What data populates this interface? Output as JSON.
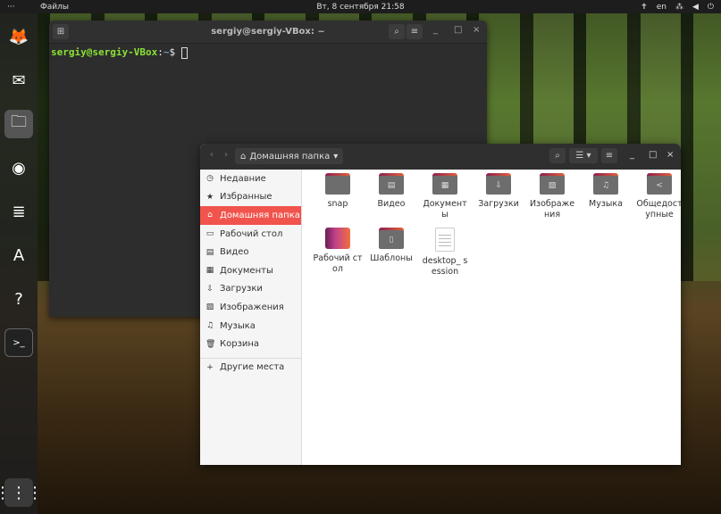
{
  "topbar": {
    "activities": "···",
    "app": "Файлы",
    "clock": "Вт, 8 сентября  21:58",
    "tray": [
      "accessibility-icon",
      "en",
      "network-icon",
      "volume-icon",
      "power-icon"
    ],
    "lang": "en"
  },
  "dock": [
    {
      "name": "firefox-icon",
      "glyph": "🦊"
    },
    {
      "name": "thunderbird-icon",
      "glyph": "✉"
    },
    {
      "name": "files-icon",
      "glyph": "🗀"
    },
    {
      "name": "rhythmbox-icon",
      "glyph": "◉"
    },
    {
      "name": "writer-icon",
      "glyph": "≣"
    },
    {
      "name": "software-icon",
      "glyph": "A"
    },
    {
      "name": "help-icon",
      "glyph": "?"
    },
    {
      "name": "terminal-icon",
      "glyph": ">_"
    }
  ],
  "terminal": {
    "title": "sergiy@sergiy-VBox: ~",
    "user": "sergiy@sergiy-VBox",
    "sep": ":",
    "path": "~",
    "dollar": "$"
  },
  "files": {
    "location": "Домашняя папка",
    "sidebar": [
      {
        "icon": "◷",
        "label": "Недавние"
      },
      {
        "icon": "★",
        "label": "Избранные"
      },
      {
        "icon": "⌂",
        "label": "Домашняя папка",
        "active": true
      },
      {
        "icon": "▭",
        "label": "Рабочий стол"
      },
      {
        "icon": "▤",
        "label": "Видео"
      },
      {
        "icon": "▦",
        "label": "Документы"
      },
      {
        "icon": "⇩",
        "label": "Загрузки"
      },
      {
        "icon": "▨",
        "label": "Изображения"
      },
      {
        "icon": "♫",
        "label": "Музыка"
      },
      {
        "icon": "🗑",
        "label": "Корзина"
      },
      {
        "icon": "+",
        "label": "Другие места"
      }
    ],
    "items": [
      {
        "label": "snap",
        "type": "folder",
        "glyph": ""
      },
      {
        "label": "Видео",
        "type": "folder",
        "glyph": "▤"
      },
      {
        "label": "Документы",
        "type": "folder",
        "glyph": "▦"
      },
      {
        "label": "Загрузки",
        "type": "folder",
        "glyph": "⇩"
      },
      {
        "label": "Изображения",
        "type": "folder",
        "glyph": "▨"
      },
      {
        "label": "Музыка",
        "type": "folder",
        "glyph": "♫"
      },
      {
        "label": "Общедоступные",
        "type": "folder",
        "glyph": "<"
      },
      {
        "label": "Рабочий стол",
        "type": "desktop",
        "glyph": ""
      },
      {
        "label": "Шаблоны",
        "type": "folder",
        "glyph": "▯"
      },
      {
        "label": "desktop_ session",
        "type": "file",
        "glyph": ""
      }
    ]
  }
}
